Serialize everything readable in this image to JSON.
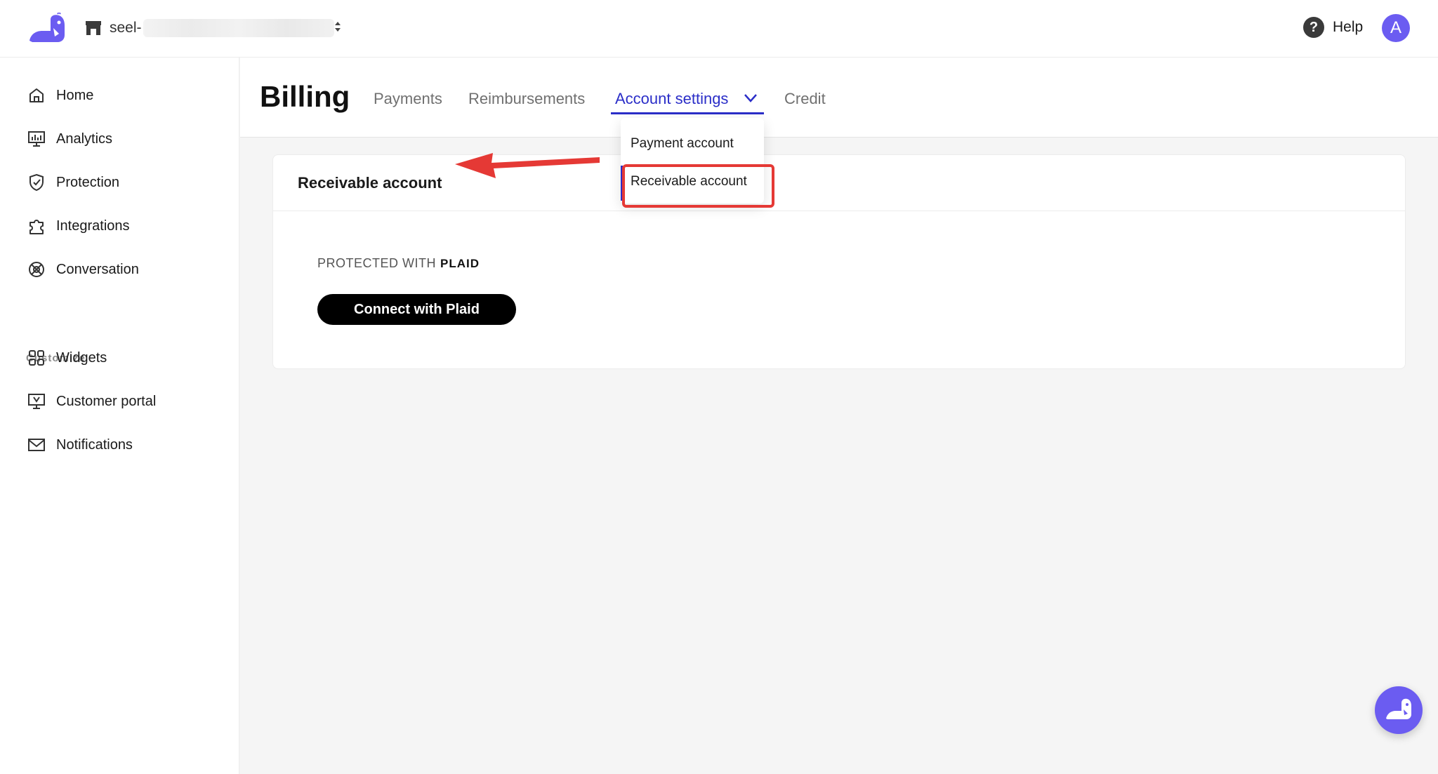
{
  "topbar": {
    "store_name": "seel-",
    "help_label": "Help",
    "avatar_initial": "A"
  },
  "sidebar": {
    "items": [
      {
        "label": "Home",
        "icon": "home-icon"
      },
      {
        "label": "Analytics",
        "icon": "analytics-icon"
      },
      {
        "label": "Protection",
        "icon": "shield-check-icon"
      },
      {
        "label": "Integrations",
        "icon": "puzzle-icon"
      },
      {
        "label": "Conversation",
        "icon": "conversation-icon"
      },
      {
        "label": "Widgets",
        "icon": "widgets-grid-icon"
      },
      {
        "label": "Customer portal",
        "icon": "monitor-icon"
      },
      {
        "label": "Notifications",
        "icon": "mail-icon"
      }
    ],
    "section_customize": "Customize"
  },
  "header": {
    "title": "Billing",
    "tabs": [
      {
        "label": "Payments"
      },
      {
        "label": "Reimbursements"
      },
      {
        "label": "Account settings",
        "active": true
      },
      {
        "label": "Credit"
      }
    ]
  },
  "dropdown": {
    "items": [
      {
        "label": "Payment account"
      },
      {
        "label": "Receivable account",
        "selected": true
      }
    ]
  },
  "card": {
    "title": "Receivable account",
    "protected_prefix": "PROTECTED WITH",
    "protected_brand": "PLAID",
    "connect_button": "Connect with Plaid"
  },
  "colors": {
    "accent": "#2b2ec8",
    "brand": "#6b5cf1",
    "annotation": "#e53935"
  }
}
